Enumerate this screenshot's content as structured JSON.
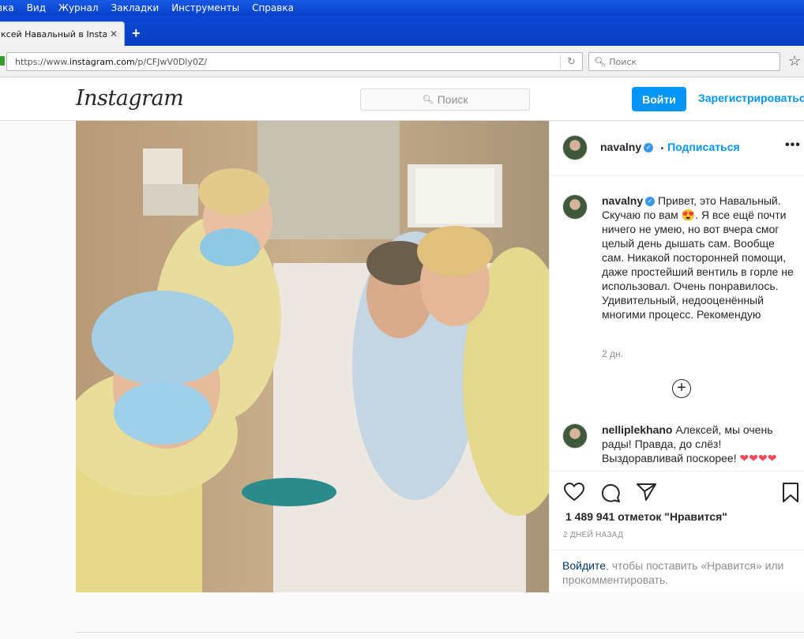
{
  "browser": {
    "menu": [
      "вка",
      "Вид",
      "Журнал",
      "Закладки",
      "Инструменты",
      "Справка"
    ],
    "tab_title": "ксей Навальный в Insta...",
    "tab_close": "✕",
    "new_tab": "+",
    "url_prefix": "https://www.",
    "url_domain": "instagram.com",
    "url_rest": "/p/CFJwV0Dly0Z/",
    "reload_icon": "↻",
    "search_placeholder": "Поиск",
    "bookmark_icon": "☆"
  },
  "instagram": {
    "logo": "Instagram",
    "search_placeholder": "Поиск",
    "login_button": "Войти",
    "signup_link": "Зарегистрироваться"
  },
  "post": {
    "author": "navalny",
    "follow_label": "Подписаться",
    "more_label": "•••",
    "caption_author": "navalny",
    "caption_text": "Привет, это Навальный. Скучаю по вам 😍. Я все ещё почти ничего не умею, но вот вчера смог целый день дышать сам. Вообще сам. Никакой посторонней помощи, даже простейший вентиль в горле не использовал. Очень понравилось. Удивительный, недооценённый многими процесс. Рекомендую",
    "caption_time": "2 дн.",
    "load_more": "+",
    "comment_author": "nelliplekhano",
    "comment_text": "Алексей, мы очень рады! Правда, до слёз! Выздоравливай поскорее!",
    "comment_hearts": "❤❤❤❤",
    "likes_text": "1 489 941 отметок \"Нравится\"",
    "date_text": "2 ДНЕЙ НАЗАД",
    "login_link": "Войдите",
    "login_prompt": ", чтобы поставить «Нравится» или прокомментировать."
  },
  "icons": [
    "lock-icon",
    "reload-icon",
    "search-icon",
    "star-icon",
    "verified-icon",
    "heart-icon",
    "comment-icon",
    "share-icon",
    "bookmark-icon",
    "add-circle-icon"
  ],
  "colors": {
    "ig_blue": "#0095f6",
    "browser_blue": "#0a4ad8",
    "heart_red": "#ed4956"
  }
}
